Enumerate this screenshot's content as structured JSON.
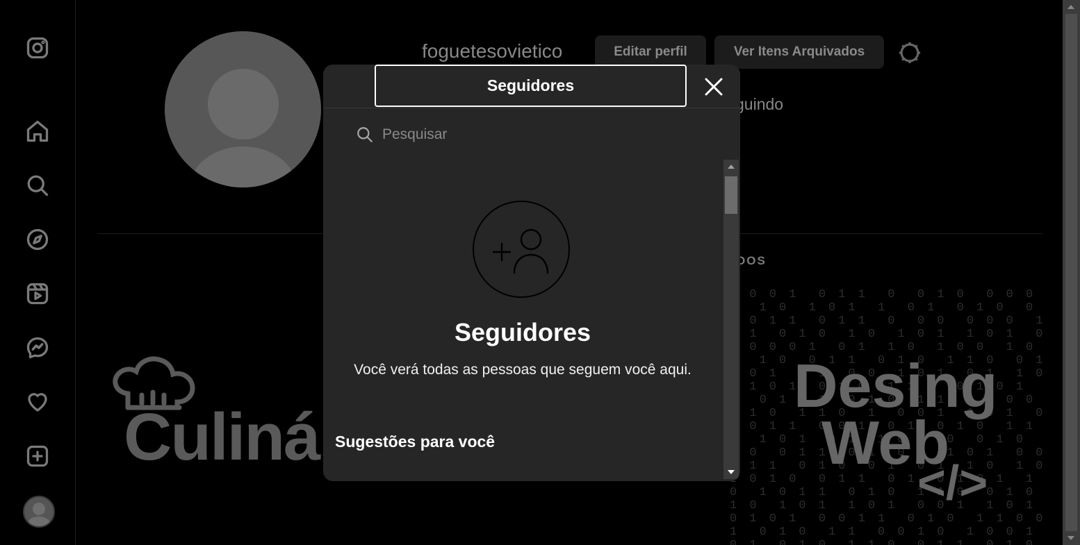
{
  "sidebar": {
    "items": [
      {
        "icon": "instagram-logo-icon"
      },
      {
        "icon": "home-icon"
      },
      {
        "icon": "search-icon"
      },
      {
        "icon": "explore-icon"
      },
      {
        "icon": "reels-icon"
      },
      {
        "icon": "messenger-icon"
      },
      {
        "icon": "heart-icon"
      },
      {
        "icon": "create-icon"
      },
      {
        "icon": "profile-avatar-icon"
      }
    ]
  },
  "profile": {
    "username": "foguetesovietico",
    "edit_label": "Editar perfil",
    "archived_label": "Ver Itens Arquivados",
    "following_text": "guindo",
    "saved_tab": "DOS"
  },
  "posts": {
    "culinaria_text": "Culinár",
    "design_line1": "Desing",
    "design_line2": "Web",
    "design_symbol": "</>"
  },
  "modal": {
    "title": "Seguidores",
    "search_placeholder": "Pesquisar",
    "empty_title": "Seguidores",
    "empty_text": "Você verá todas as pessoas que seguem você aqui.",
    "suggestions_title": "Sugestões para você"
  },
  "colors": {
    "modal_bg": "#262626",
    "page_bg": "#000000",
    "dim_text": "#888888"
  }
}
